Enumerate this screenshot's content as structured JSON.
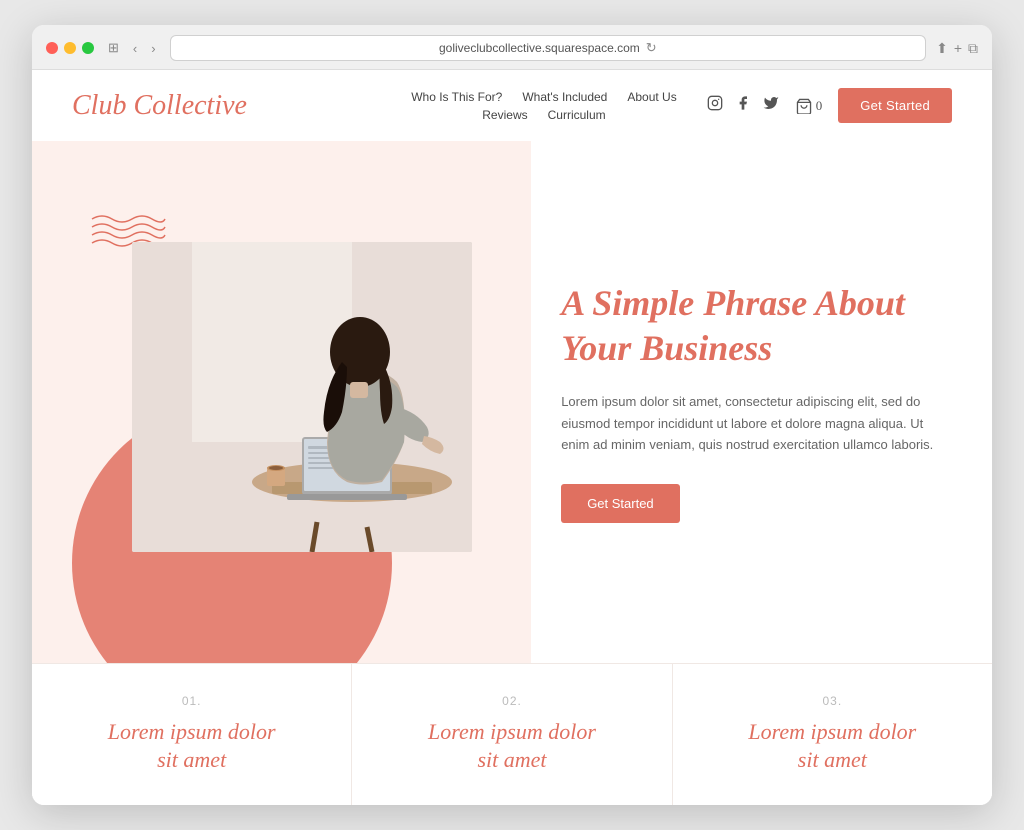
{
  "browser": {
    "url": "goliveclubcollective.squarespace.com"
  },
  "nav": {
    "logo": "Club Collective",
    "links_row1": [
      "Who Is This For?",
      "What's Included",
      "About Us"
    ],
    "links_row2": [
      "Reviews",
      "Curriculum"
    ],
    "cart_count": "0",
    "cta_label": "Get Started"
  },
  "hero": {
    "title": "A Simple Phrase About Your Business",
    "body": "Lorem ipsum dolor sit amet, consectetur adipiscing elit, sed do eiusmod tempor incididunt ut labore et dolore magna aliqua. Ut enim ad minim veniam, quis nostrud exercitation ullamco laboris.",
    "cta_label": "Get Started"
  },
  "features": [
    {
      "num": "01.",
      "title": "Lorem ipsum dolor sit amet"
    },
    {
      "num": "02.",
      "title": "Lorem ipsum dolor sit amet"
    },
    {
      "num": "03.",
      "title": "Lorem ipsum dolor sit amet"
    }
  ]
}
